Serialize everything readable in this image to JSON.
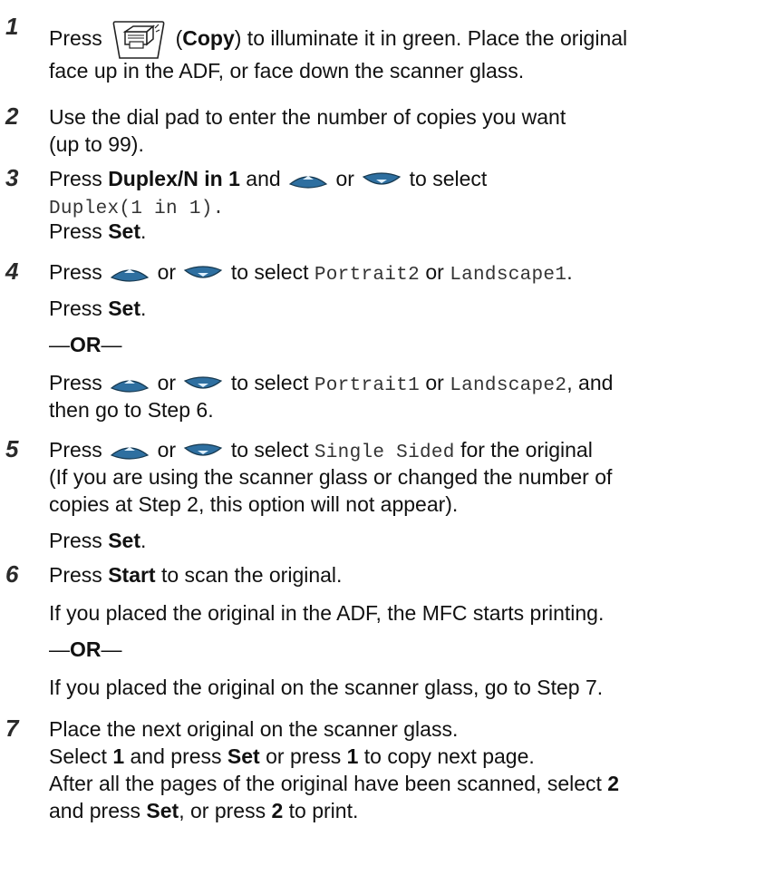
{
  "steps": [
    {
      "number": "1",
      "lines": [
        [
          "Press ",
          "[copy-key-icon]",
          " (",
          "Copy",
          ") to illuminate it in green. Place the original"
        ],
        [
          "face up in the ADF, or face down the scanner glass."
        ]
      ]
    },
    {
      "number": "2",
      "lines": [
        [
          "Use the dial pad to enter the number of copies you want"
        ],
        [
          "(up to 99)."
        ]
      ]
    },
    {
      "number": "3",
      "lines": [
        [
          "Press ",
          "Duplex/N in 1",
          " and ",
          "[up-arrow-icon]",
          " or ",
          "[down-arrow-icon]",
          " to select"
        ],
        [
          "Duplex(1 in 1)."
        ],
        [
          "Press ",
          "Set",
          "."
        ]
      ]
    },
    {
      "number": "4",
      "lines": [
        [
          "Press ",
          "[up-arrow-icon]",
          " or ",
          "[down-arrow-icon]",
          " to select ",
          "Portrait2",
          " or ",
          "Landscape1",
          "."
        ],
        [
          "Press ",
          "Set",
          "."
        ],
        [
          "—",
          "OR",
          "—"
        ],
        [
          "Press ",
          "[up-arrow-icon]",
          " or ",
          "[down-arrow-icon]",
          " to select ",
          "Portrait1",
          " or ",
          "Landscape2",
          ", and"
        ],
        [
          "then go to Step 6."
        ]
      ]
    },
    {
      "number": "5",
      "lines": [
        [
          "Press ",
          "[up-arrow-icon]",
          " or ",
          "[down-arrow-icon]",
          " to select ",
          "Single Sided",
          " for the original"
        ],
        [
          "(If you are using the scanner glass or changed the number of"
        ],
        [
          "copies at Step 2, this option will not appear)."
        ],
        [
          "Press ",
          "Set",
          "."
        ]
      ]
    },
    {
      "number": "6",
      "lines": [
        [
          "Press ",
          "Start",
          " to scan the original."
        ],
        [
          "If you placed the original in the ADF, the MFC starts printing."
        ],
        [
          "—",
          "OR",
          "—"
        ],
        [
          "If you placed the original on the scanner glass, go to Step 7."
        ]
      ]
    },
    {
      "number": "7",
      "lines": [
        [
          "Place the next original on the scanner glass."
        ],
        [
          "Select ",
          "1",
          " and press ",
          "Set",
          " or press ",
          "1",
          " to copy next page."
        ],
        [
          "After all the pages of the original have been scanned, select ",
          "2"
        ],
        [
          "and press ",
          "Set",
          ", or press ",
          "2",
          " to print."
        ]
      ]
    }
  ]
}
